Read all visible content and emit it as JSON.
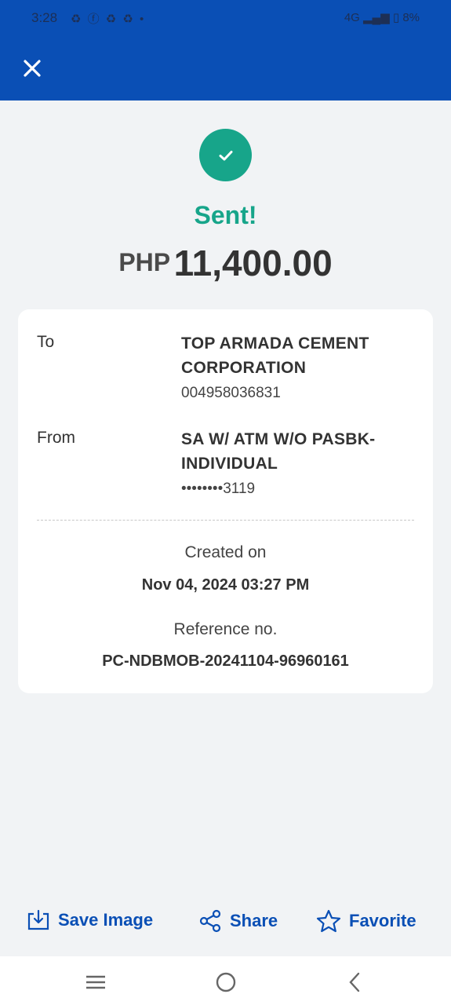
{
  "status_bar": {
    "time": "3:28",
    "notification_icons": "♻ ⓕ ♻ ♻ •",
    "network": "4G",
    "battery": "8%"
  },
  "header": {
    "close_icon": "close-icon"
  },
  "result": {
    "status": "Sent!",
    "currency": "PHP",
    "amount": "11,400.00"
  },
  "details": {
    "to_label": "To",
    "to_name": "TOP ARMADA CEMENT CORPORATION",
    "to_account": "004958036831",
    "from_label": "From",
    "from_name": "SA W/ ATM W/O PASBK-INDIVIDUAL",
    "from_account": "••••••••3119",
    "created_label": "Created on",
    "created_value": "Nov 04, 2024 03:27 PM",
    "reference_label": "Reference no.",
    "reference_value": "PC-NDBMOB-20241104-96960161"
  },
  "actions": {
    "save_image": "Save Image",
    "share": "Share",
    "favorite": "Favorite"
  },
  "colors": {
    "header": "#0a4fb5",
    "success": "#17a58a",
    "action": "#0a4fb5"
  }
}
